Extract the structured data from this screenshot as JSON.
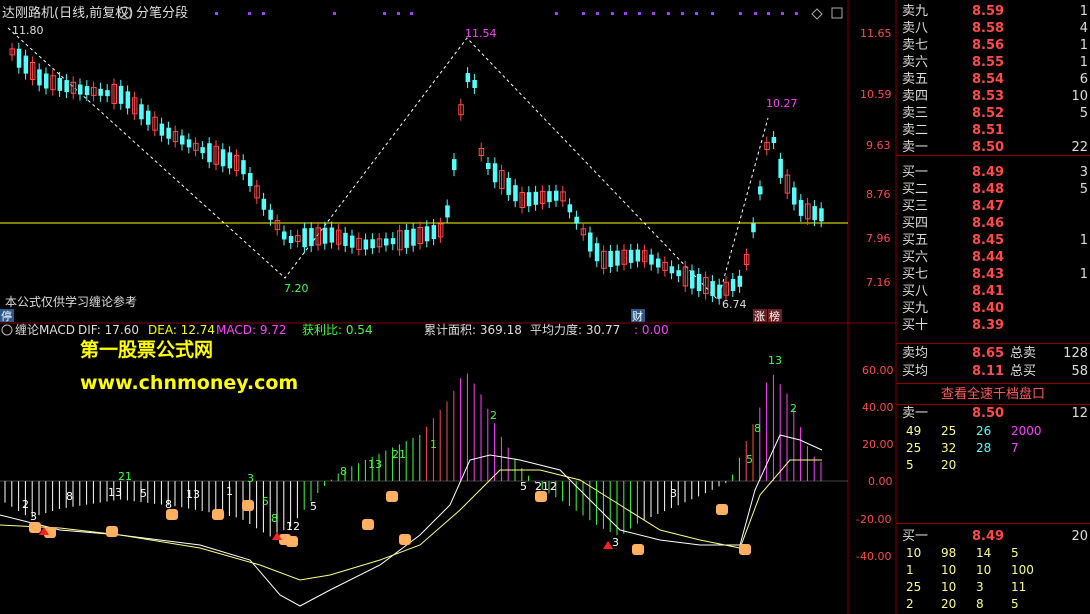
{
  "top_panel": {
    "title": "达刚路机(日线,前复权)",
    "period_selector": "分笔分段",
    "note": "本公式仅供学习缠论参考",
    "badges": {
      "ting": "停",
      "cai": "财",
      "zhang": "涨",
      "bang": "榜"
    },
    "annotations": {
      "high_left": "11.80",
      "peak": "11.54",
      "low1": "7.20",
      "low2": "6.74",
      "peak2": "10.27"
    },
    "y_ticks": [
      "11.65",
      "10.59",
      "9.63",
      "8.76",
      "7.96",
      "7.16"
    ]
  },
  "bottom_panel": {
    "indicator": "缠论MACD",
    "dif": "DIF: 17.60",
    "dea": "DEA: 12.74",
    "macd": "MACD: 9.72",
    "winrate": "获利比: 0.54",
    "area": "累计面积: 369.18",
    "force": "平均力度: 30.77",
    "extra": ": 0.00",
    "y_ticks": [
      "60.00",
      "40.00",
      "20.00",
      "0.00",
      "-20.00",
      "-40.00"
    ],
    "bar_labels": [
      "2",
      "3",
      "8",
      "13",
      "21",
      "5",
      "8",
      "13",
      "1",
      "3",
      "5",
      "8",
      "12",
      "5",
      "8",
      "13",
      "21",
      "1",
      "2",
      "5",
      "21",
      "2",
      "3",
      "5",
      "8",
      "13"
    ]
  },
  "watermark": {
    "line1": "第一股票公式网",
    "line2": "www.chnmoney.com"
  },
  "orderbook": {
    "asks": [
      {
        "label": "卖九",
        "price": "8.59",
        "vol": "1"
      },
      {
        "label": "卖八",
        "price": "8.58",
        "vol": "4"
      },
      {
        "label": "卖七",
        "price": "8.56",
        "vol": "1"
      },
      {
        "label": "卖六",
        "price": "8.55",
        "vol": "1"
      },
      {
        "label": "卖五",
        "price": "8.54",
        "vol": "6"
      },
      {
        "label": "卖四",
        "price": "8.53",
        "vol": "10"
      },
      {
        "label": "卖三",
        "price": "8.52",
        "vol": "5"
      },
      {
        "label": "卖二",
        "price": "8.51",
        "vol": ""
      },
      {
        "label": "卖一",
        "price": "8.50",
        "vol": "22"
      }
    ],
    "bids": [
      {
        "label": "买一",
        "price": "8.49",
        "vol": "3"
      },
      {
        "label": "买二",
        "price": "8.48",
        "vol": "5"
      },
      {
        "label": "买三",
        "price": "8.47",
        "vol": ""
      },
      {
        "label": "买四",
        "price": "8.46",
        "vol": ""
      },
      {
        "label": "买五",
        "price": "8.45",
        "vol": "1"
      },
      {
        "label": "买六",
        "price": "8.44",
        "vol": ""
      },
      {
        "label": "买七",
        "price": "8.43",
        "vol": "1"
      },
      {
        "label": "买八",
        "price": "8.41",
        "vol": ""
      },
      {
        "label": "买九",
        "price": "8.40",
        "vol": ""
      },
      {
        "label": "买十",
        "price": "8.39",
        "vol": ""
      }
    ],
    "avg_sell": {
      "label": "卖均",
      "price": "8.65",
      "total_label": "总卖",
      "total": "128"
    },
    "avg_buy": {
      "label": "买均",
      "price": "8.11",
      "total_label": "总买",
      "total": "58"
    },
    "button": "查看全速千档盘口",
    "sell1_detail": {
      "label": "卖一",
      "price": "8.50",
      "vol": "12",
      "rows": [
        [
          "49",
          "25",
          "26",
          "2000"
        ],
        [
          "25",
          "32",
          "28",
          "7"
        ],
        [
          "5",
          "20",
          "",
          ""
        ]
      ]
    },
    "buy1_detail": {
      "label": "买一",
      "price": "8.49",
      "vol": "20",
      "rows": [
        [
          "10",
          "98",
          "14",
          "5"
        ],
        [
          "1",
          "10",
          "10",
          "100"
        ],
        [
          "25",
          "10",
          "3",
          "11"
        ],
        [
          "2",
          "20",
          "8",
          "5"
        ]
      ]
    }
  },
  "colors": {
    "up": "#ff4a4a",
    "down": "#55ffff",
    "grid": "#800000",
    "yellow": "#ffff00",
    "magenta": "#ff40ff",
    "green": "#40ff40"
  }
}
